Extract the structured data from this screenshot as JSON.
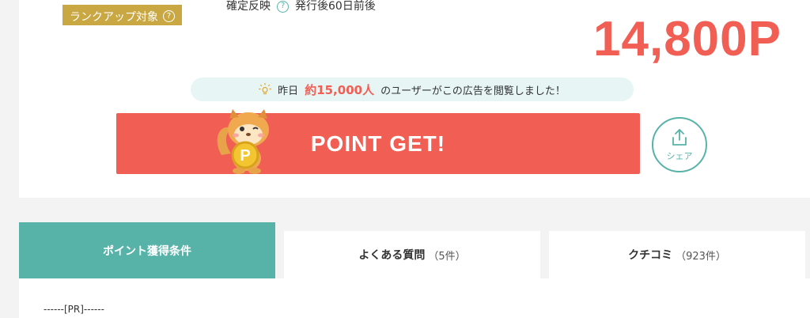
{
  "badge": {
    "label": "ランクアップ対象",
    "help": "?"
  },
  "confirm": {
    "label": "確定反映",
    "help": "?",
    "value": "発行後60日前後"
  },
  "points": "14,800P",
  "viewers": {
    "prefix": "昨日",
    "count": "約15,000人",
    "suffix": "のユーザーがこの広告を閲覧しました！"
  },
  "get_button": {
    "label": "POINT GET!",
    "coin_letter": "P"
  },
  "share": {
    "label": "シェア"
  },
  "tabs": [
    {
      "label": "ポイント獲得条件",
      "count": ""
    },
    {
      "label": "よくある質問",
      "count": "（5件）"
    },
    {
      "label": "クチコミ",
      "count": "（923件）"
    }
  ],
  "content": {
    "pr_line": "------[PR]------"
  },
  "colors": {
    "accent": "#f05e54",
    "teal": "#57b2a8",
    "gold": "#c9a743"
  }
}
